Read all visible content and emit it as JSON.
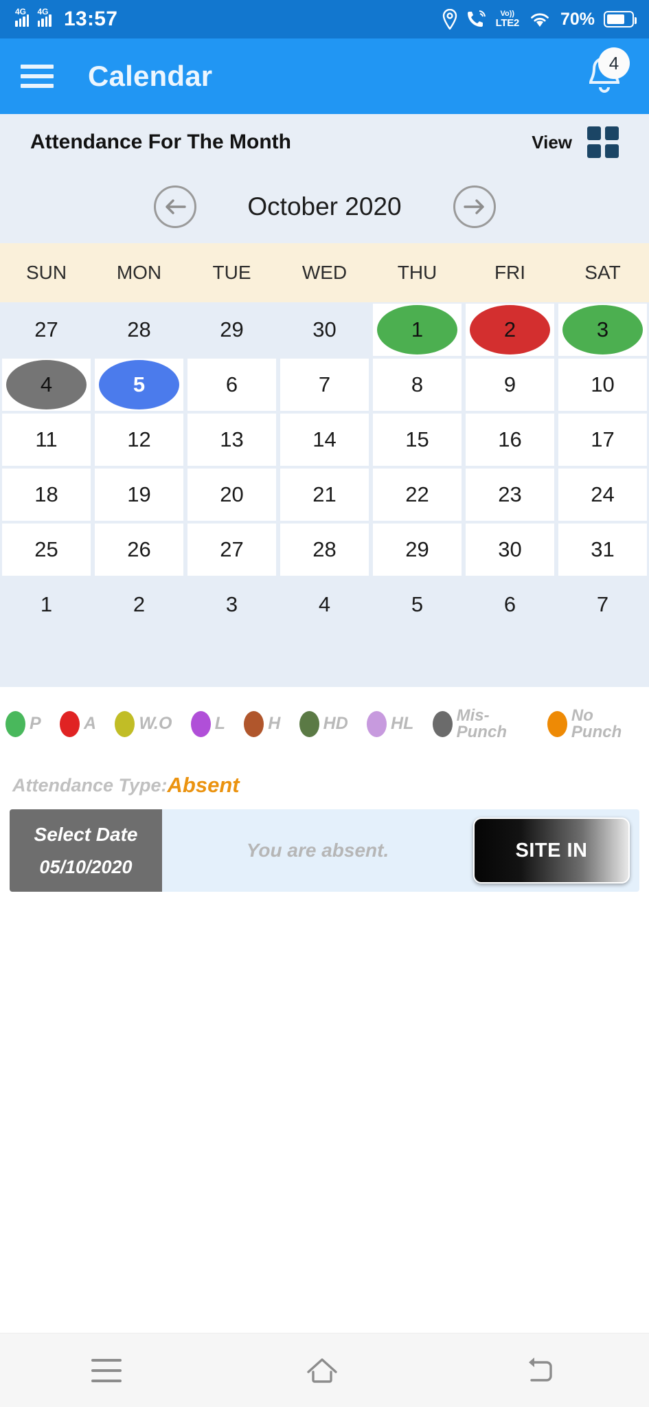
{
  "status_bar": {
    "network_1": "4G",
    "network_2": "4G",
    "time": "13:57",
    "volte_top": "Vo))",
    "volte_bottom": "LTE2",
    "battery_percent": "70%",
    "icons": [
      "signal-4g-icon",
      "signal-4g-icon",
      "location-icon",
      "call-wifi-icon",
      "volte-icon",
      "wifi-icon",
      "battery-icon"
    ]
  },
  "app_bar": {
    "menu_icon": "hamburger-menu-icon",
    "title": "Calendar",
    "notification_icon": "bell-icon",
    "notification_count": "4"
  },
  "attendance_header": {
    "title": "Attendance For The Month",
    "view_label": "View",
    "view_icon": "grid-view-icon"
  },
  "month_nav": {
    "prev_icon": "arrow-left-icon",
    "next_icon": "arrow-right-icon",
    "month_label": "October 2020"
  },
  "weekdays": [
    "SUN",
    "MON",
    "TUE",
    "WED",
    "THU",
    "FRI",
    "SAT"
  ],
  "calendar": {
    "rows": [
      [
        {
          "day": "27",
          "state": "outside"
        },
        {
          "day": "28",
          "state": "outside"
        },
        {
          "day": "29",
          "state": "outside"
        },
        {
          "day": "30",
          "state": "outside"
        },
        {
          "day": "1",
          "state": "present",
          "color": "#4caf50"
        },
        {
          "day": "2",
          "state": "absent",
          "color": "#d32f2f"
        },
        {
          "day": "3",
          "state": "present",
          "color": "#4caf50"
        }
      ],
      [
        {
          "day": "4",
          "state": "mis-punch",
          "color": "#757575"
        },
        {
          "day": "5",
          "state": "selected",
          "color": "#4b7bec"
        },
        {
          "day": "6",
          "state": "normal"
        },
        {
          "day": "7",
          "state": "normal"
        },
        {
          "day": "8",
          "state": "normal"
        },
        {
          "day": "9",
          "state": "normal"
        },
        {
          "day": "10",
          "state": "normal"
        }
      ],
      [
        {
          "day": "11",
          "state": "normal"
        },
        {
          "day": "12",
          "state": "normal"
        },
        {
          "day": "13",
          "state": "normal"
        },
        {
          "day": "14",
          "state": "normal"
        },
        {
          "day": "15",
          "state": "normal"
        },
        {
          "day": "16",
          "state": "normal"
        },
        {
          "day": "17",
          "state": "normal"
        }
      ],
      [
        {
          "day": "18",
          "state": "normal"
        },
        {
          "day": "19",
          "state": "normal"
        },
        {
          "day": "20",
          "state": "normal"
        },
        {
          "day": "21",
          "state": "normal"
        },
        {
          "day": "22",
          "state": "normal"
        },
        {
          "day": "23",
          "state": "normal"
        },
        {
          "day": "24",
          "state": "normal"
        }
      ],
      [
        {
          "day": "25",
          "state": "normal"
        },
        {
          "day": "26",
          "state": "normal"
        },
        {
          "day": "27",
          "state": "normal"
        },
        {
          "day": "28",
          "state": "normal"
        },
        {
          "day": "29",
          "state": "normal"
        },
        {
          "day": "30",
          "state": "normal"
        },
        {
          "day": "31",
          "state": "normal"
        }
      ],
      [
        {
          "day": "1",
          "state": "outside"
        },
        {
          "day": "2",
          "state": "outside"
        },
        {
          "day": "3",
          "state": "outside"
        },
        {
          "day": "4",
          "state": "outside"
        },
        {
          "day": "5",
          "state": "outside"
        },
        {
          "day": "6",
          "state": "outside"
        },
        {
          "day": "7",
          "state": "outside"
        }
      ]
    ]
  },
  "legend": [
    {
      "label": "P",
      "color": "#49b85c"
    },
    {
      "label": "A",
      "color": "#e02323"
    },
    {
      "label": "W.O",
      "color": "#c1bd26"
    },
    {
      "label": "L",
      "color": "#b04fd8"
    },
    {
      "label": "H",
      "color": "#b0562c"
    },
    {
      "label": "HD",
      "color": "#5b7a45"
    },
    {
      "label": "HL",
      "color": "#c79ade"
    },
    {
      "label": "Mis-Punch",
      "color": "#6b6b6b"
    },
    {
      "label": "No Punch",
      "color": "#ee8a05"
    }
  ],
  "attendance_type": {
    "label": "Attendance Type:",
    "value": "Absent",
    "value_color": "#eb9310"
  },
  "action_bar": {
    "select_date_label": "Select Date",
    "selected_date": "05/10/2020",
    "message": "You are absent.",
    "site_in_label": "SITE IN"
  },
  "nav_bar": {
    "recent_icon": "recent-apps-icon",
    "home_icon": "home-icon",
    "back_icon": "back-icon"
  }
}
